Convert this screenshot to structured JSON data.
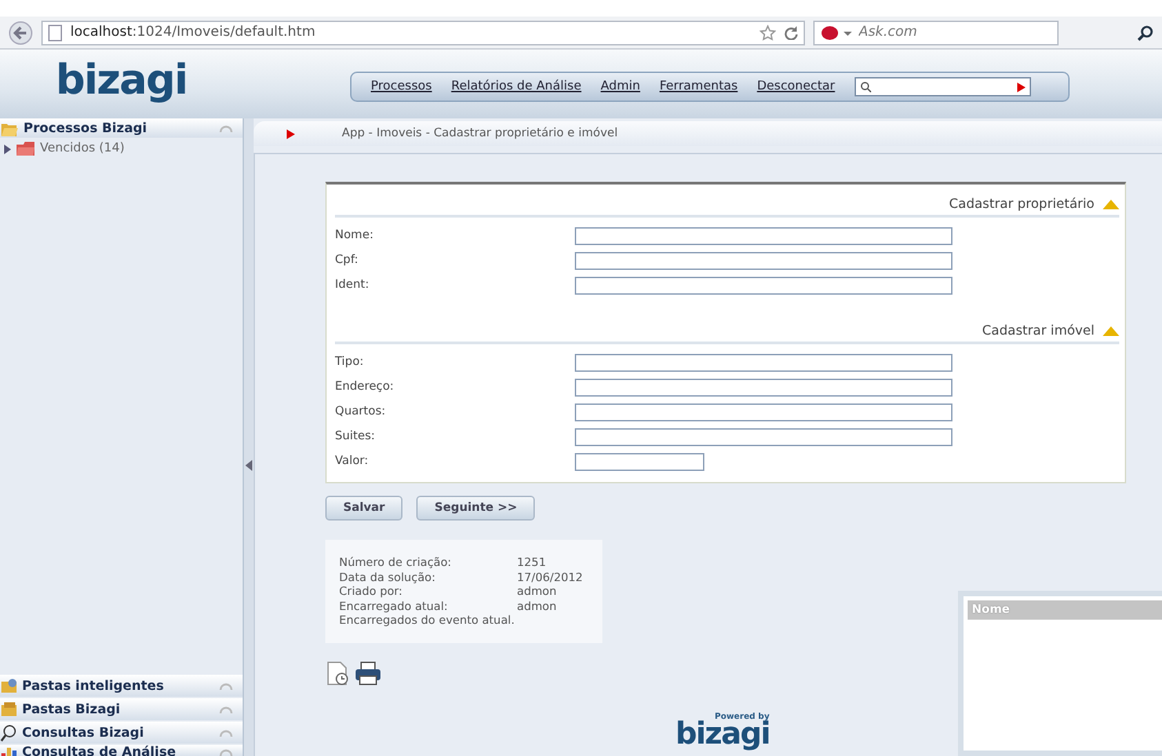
{
  "browser": {
    "url": "**localhost**:1024/Imoveis/default.htm",
    "search": {
      "placeholder": "Ask.com"
    }
  },
  "header": {
    "logo": "bizagi",
    "menu": [
      "Processos",
      "Relatórios de Análise",
      "Admin",
      "Ferramentas",
      "Desconectar"
    ]
  },
  "sidebar": {
    "top": {
      "title": "Processos Bizagi",
      "items": [
        {
          "label": "Vencidos (14)",
          "expanded": false
        }
      ]
    },
    "bottom": [
      {
        "title": "Pastas inteligentes",
        "kind": "smart"
      },
      {
        "title": "Pastas Bizagi",
        "kind": "folder"
      },
      {
        "title": "Consultas Bizagi",
        "kind": "search"
      },
      {
        "title": "Consultas de Análise",
        "kind": "chart"
      }
    ]
  },
  "breadcrumb": "App - Imoveis - Cadastrar proprietário e imóvel",
  "form": {
    "sections": [
      {
        "title": "Cadastrar proprietário",
        "expanded": true,
        "fields": [
          {
            "label": "Nome:",
            "kind": "wide"
          },
          {
            "label": "Cpf:",
            "kind": "wide"
          },
          {
            "label": "Ident:",
            "kind": "wide"
          }
        ]
      },
      {
        "title": "Cadastrar imóvel",
        "expanded": true,
        "fields": [
          {
            "label": "Tipo:",
            "kind": "wide"
          },
          {
            "label": "Endereço:",
            "kind": "wide"
          },
          {
            "label": "Quartos:",
            "kind": "wide"
          },
          {
            "label": "Suites:",
            "kind": "wide"
          },
          {
            "label": "Valor:",
            "kind": "short"
          }
        ]
      }
    ]
  },
  "buttons": [
    "Salvar",
    "Seguinte >>"
  ],
  "info": [
    {
      "label": "Número de criação:",
      "value": "1251"
    },
    {
      "label": "Data da solução:",
      "value": "17/06/2012"
    },
    {
      "label": "Criado por:",
      "value": "admon"
    },
    {
      "label": "Encarregado atual:",
      "value": "admon"
    },
    {
      "label": "Encarregados do evento atual."
    }
  ],
  "grid": {
    "columns": [
      "Nome"
    ]
  },
  "footer": {
    "powered": "Powered by",
    "logo": "bizagi"
  }
}
